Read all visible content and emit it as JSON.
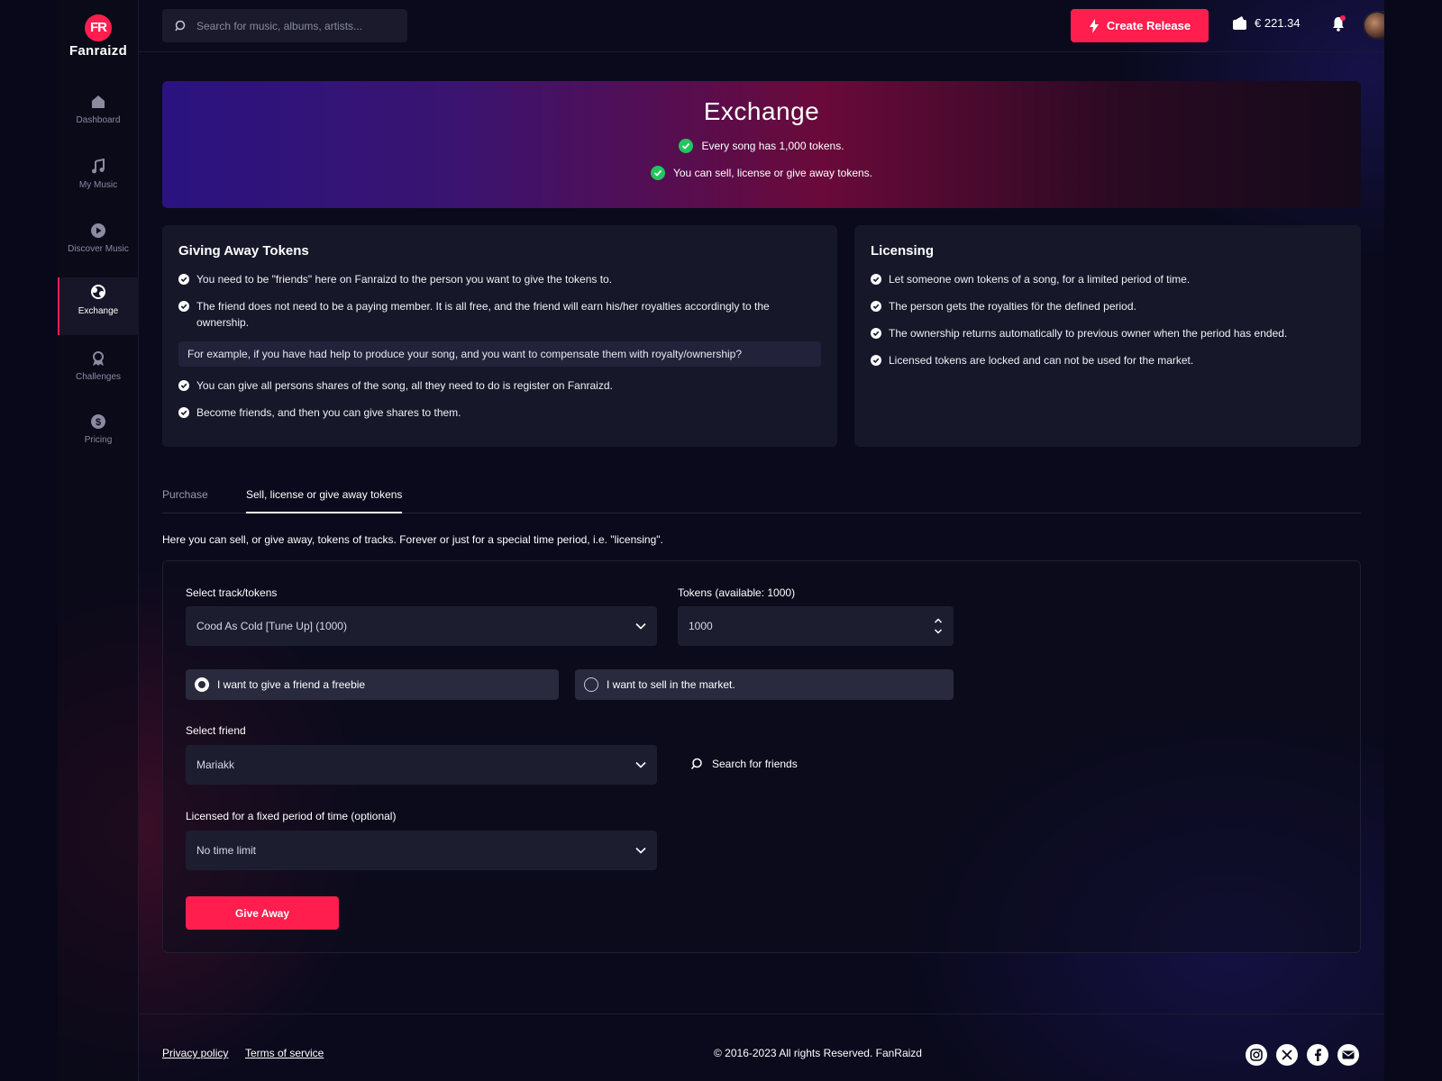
{
  "brand": {
    "badge": "FR",
    "name": "Fanraizd"
  },
  "sidebar": {
    "items": [
      {
        "label": "Dashboard",
        "icon": "home-icon"
      },
      {
        "label": "My Music",
        "icon": "music-note-icon"
      },
      {
        "label": "Discover Music",
        "icon": "play-circle-icon"
      },
      {
        "label": "Exchange",
        "icon": "exchange-icon",
        "active": true
      },
      {
        "label": "Challenges",
        "icon": "award-icon"
      },
      {
        "label": "Pricing",
        "icon": "dollar-coin-icon"
      }
    ]
  },
  "header": {
    "search_placeholder": "Search for music, albums, artists...",
    "create_label": "Create Release",
    "balance": "€ 221.34"
  },
  "hero": {
    "title": "Exchange",
    "lines": [
      "Every song has 1,000 tokens.",
      "You can sell, license or give away tokens."
    ]
  },
  "giving": {
    "title": "Giving Away Tokens",
    "items": [
      "You need to be \"friends\" here on Fanraizd to the person you want to give the tokens to.",
      "The friend does not need to be a paying member. It is all free, and the friend will earn his/her royalties accordingly to the ownership.",
      "You can give all persons shares of the song, all they need to do is register on Fanraizd.",
      "Become friends, and then you can give shares to them."
    ],
    "example": "For example, if you have had help to produce your song, and you want to compensate them with royalty/ownership?"
  },
  "licensing": {
    "title": "Licensing",
    "items": [
      "Let someone own tokens of a song, for a limited period of time.",
      "The person gets the royalties för the defined period.",
      "The ownership returns automatically to previous owner when the period has ended.",
      "Licensed tokens are locked and can not be used for the market."
    ]
  },
  "tabs": {
    "purchase": "Purchase",
    "sell": "Sell, license or give away tokens"
  },
  "intro": "Here you can sell, or give away, tokens of tracks. Forever or just for a special time period, i.e. \"licensing\".",
  "form": {
    "track_label": "Select track/tokens",
    "track_value": "Cood As Cold [Tune Up] (1000)",
    "tokens_label": "Tokens (available: 1000)",
    "tokens_value": "1000",
    "radio_freebie": "I want to give a friend a freebie",
    "radio_market": "I want to sell in the market.",
    "friend_label": "Select friend",
    "friend_value": "Mariakk",
    "search_friends": "Search for friends",
    "period_label": "Licensed for a fixed period of time (optional)",
    "period_value": "No time limit",
    "submit": "Give Away"
  },
  "footer": {
    "privacy": "Privacy policy",
    "terms": "Terms of service",
    "copyright": "© 2016-2023 All rights Reserved. FanRaizd",
    "social": [
      "instagram-icon",
      "x-icon",
      "facebook-icon",
      "mail-icon"
    ]
  },
  "colors": {
    "accent": "#ff1e4e",
    "check_green": "#22c55e",
    "card_bg": "#17172a"
  }
}
